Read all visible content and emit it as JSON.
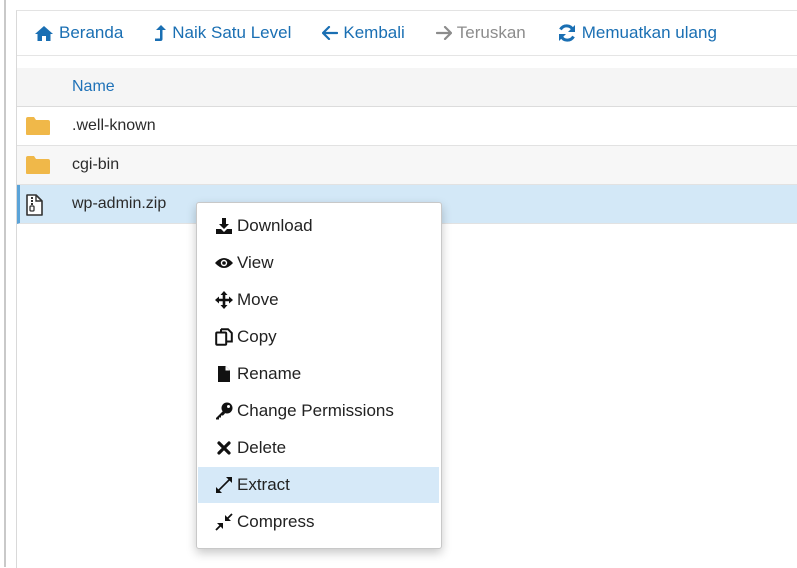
{
  "toolbar": {
    "home_label": "Beranda",
    "up_label": "Naik Satu Level",
    "back_label": "Kembali",
    "forward_label": "Teruskan",
    "reload_label": "Memuatkan ulang"
  },
  "table": {
    "header_name": "Name",
    "rows": [
      {
        "name": ".well-known",
        "type": "folder"
      },
      {
        "name": "cgi-bin",
        "type": "folder"
      },
      {
        "name": "wp-admin.zip",
        "type": "zip",
        "selected": true
      }
    ]
  },
  "context_menu": {
    "items": [
      {
        "label": "Download",
        "icon": "download-icon"
      },
      {
        "label": "View",
        "icon": "eye-icon"
      },
      {
        "label": "Move",
        "icon": "move-arrows-icon"
      },
      {
        "label": "Copy",
        "icon": "copy-icon"
      },
      {
        "label": "Rename",
        "icon": "file-icon"
      },
      {
        "label": "Change Permissions",
        "icon": "key-icon"
      },
      {
        "label": "Delete",
        "icon": "x-icon"
      },
      {
        "label": "Extract",
        "icon": "expand-icon",
        "highlighted": true
      },
      {
        "label": "Compress",
        "icon": "compress-icon"
      }
    ]
  },
  "colors": {
    "link_blue": "#1a6fb3",
    "disabled_gray": "#8c8c8c",
    "folder_yellow": "#f0b849",
    "selected_row": "#d3e8f7",
    "menu_highlight": "#d6e9f8"
  }
}
